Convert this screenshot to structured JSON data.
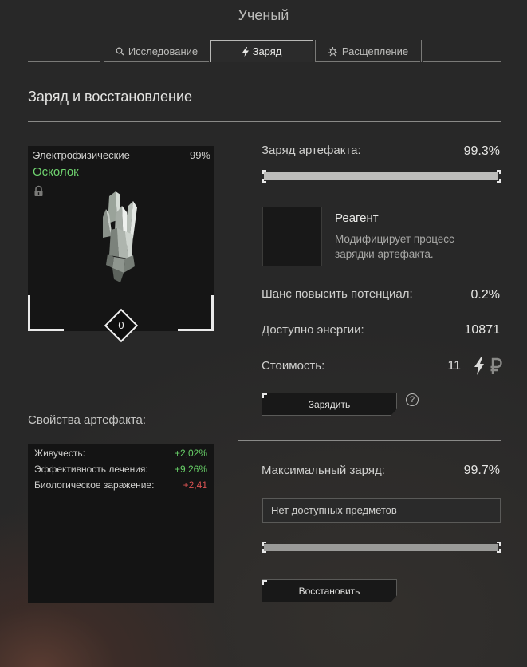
{
  "window": {
    "title": "Ученый"
  },
  "tabs": [
    {
      "label": "Исследование",
      "icon": "magnifier-icon",
      "active": false
    },
    {
      "label": "Заряд",
      "icon": "lightning-icon",
      "active": true
    },
    {
      "label": "Расщепление",
      "icon": "splitting-icon",
      "active": false
    }
  ],
  "section": {
    "title": "Заряд и восстановление"
  },
  "artifact": {
    "category": "Электрофизические",
    "percent": "99%",
    "name": "Осколок",
    "name_color": "#6fd36f",
    "locked_icon": "lock-icon",
    "image_icon": "crystal-icon",
    "level": "0"
  },
  "properties": {
    "label": "Свойства артефакта:",
    "items": [
      {
        "name": "Живучесть:",
        "value": "+2,02%",
        "tone": "positive"
      },
      {
        "name": "Эффективность лечения:",
        "value": "+9,26%",
        "tone": "positive"
      },
      {
        "name": "Биологическое заражение:",
        "value": "+2,41",
        "tone": "negative"
      }
    ],
    "colors": {
      "positive": "#67cf67",
      "negative": "#d95252"
    }
  },
  "charge": {
    "label": "Заряд артефакта:",
    "value": "99.3%",
    "fill_fraction": 0.993,
    "reagent": {
      "title": "Реагент",
      "description": "Модифицирует процесс зарядки артефакта."
    },
    "potential_label": "Шанс повысить потенциал:",
    "potential_value": "0.2%",
    "energy_label": "Доступно энергии:",
    "energy_value": "10871",
    "cost_label": "Стоимость:",
    "cost_value": "11",
    "cost_icons": [
      "lightning-icon",
      "ruble-icon"
    ],
    "button_label": "Зарядить",
    "help_glyph": "?"
  },
  "restore": {
    "label": "Максимальный заряд:",
    "value": "99.7%",
    "fill_fraction": 0.997,
    "select_value": "Нет доступных предметов",
    "button_label": "Восстановить"
  }
}
